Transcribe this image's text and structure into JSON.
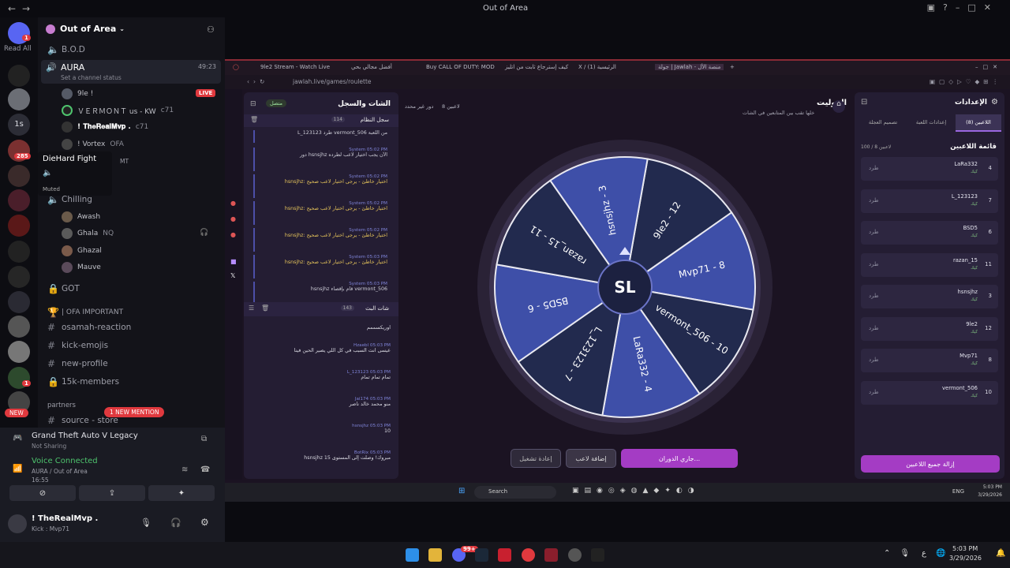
{
  "window": {
    "title": "Out of Area"
  },
  "rail": {
    "read_all": "Read All",
    "badges": [
      "1",
      "285",
      "1",
      "1",
      "1"
    ],
    "new_label": "NEW"
  },
  "server": {
    "name": "Out of Area"
  },
  "channels": {
    "bod": "B.O.D",
    "aura": "AURA",
    "aura_timer": "49:23",
    "aura_status": "Set a channel status",
    "chilling": "Chilling",
    "got": "GOT",
    "category": "| OFA IMPORTANT",
    "text": [
      "osamah-reaction",
      "kick-emojis",
      "new-profile",
      "15k-members"
    ],
    "partners": "partners",
    "source": "source - store",
    "mention_pill": "1 NEW MENTION"
  },
  "voice_users": [
    {
      "name": "9le !",
      "extra": "",
      "live": "LIVE"
    },
    {
      "name": "ＶＥＲＭＯＮＴ us - KW",
      "extra": "c71"
    },
    {
      "name": "! 𝐓𝐡𝐞𝐑𝐞𝐚𝐥𝐌𝐯𝐩 .",
      "extra": "c71"
    },
    {
      "name": "! Vortex",
      "extra": "OFA"
    }
  ],
  "chilling_users": [
    "Awash",
    "Ghala",
    "Ghazal",
    "Mauve"
  ],
  "chilling_extra": "NQ",
  "tooltip": {
    "title": "DieHard Fight",
    "muted": "Muted",
    "tag": "MT"
  },
  "voice_panel": {
    "game": "Grand Theft Auto V Legacy",
    "sharing": "Not Sharing",
    "connected": "Voice Connected",
    "channel": "AURA / Out of Area",
    "time": "16:55"
  },
  "user_panel": {
    "name": "! TheRealMvp .",
    "status": "Kick : Mvp71"
  },
  "browser": {
    "tabs": [
      "9le2 Stream - Watch Live",
      "أفضل مجالي بحي",
      "Buy CALL OF DUTY: MOD",
      "كيف إسترجاع ثابت من اتليز",
      "X / الرئيسية (1)",
      "جولة | Jawlah - منصة الأل"
    ],
    "url": "jawlah.live/games/roulette"
  },
  "chat_panel": {
    "title": "الشات والسجل",
    "online": "متصل",
    "log_title": "سجل النظام",
    "log_count": "114",
    "live_chat_title": "شات البث",
    "live_count": "143",
    "log": [
      {
        "meta": "",
        "text": "L_123123 طرد vermont_506 من اللعبة",
        "warn": false
      },
      {
        "meta": "System  05:02 PM",
        "text": "دور hsnsjhz الآن يجب اختيار لاعب لطرده",
        "warn": false
      },
      {
        "meta": "System  05:02 PM",
        "text": "hsnsjhz: اختيار خاطئ - يرجى اختيار لاعب صحيح",
        "warn": true
      },
      {
        "meta": "System  05:02 PM",
        "text": "hsnsjhz: اختيار خاطئ - يرجى اختيار لاعب صحيح",
        "warn": true
      },
      {
        "meta": "System  05:02 PM",
        "text": "hsnsjhz: اختيار خاطئ - يرجى اختيار لاعب صحيح",
        "warn": true
      },
      {
        "meta": "System  05:03 PM",
        "text": "hsnsjhz: اختيار خاطئ - يرجى اختيار لاعب صحيح",
        "warn": true
      },
      {
        "meta": "System  05:03 PM",
        "text": "hsnsjhz قام بإقصاء vermont_506",
        "warn": false
      }
    ],
    "messages": [
      {
        "meta": "",
        "text": "اوريكسممم"
      },
      {
        "meta": "Hzaebl  05:03 PM",
        "text": "عيسى انت السبب في كل اللي يصير الحين فينا"
      },
      {
        "meta": "L_123123  05:03 PM",
        "text": "تمام تمام تمام"
      },
      {
        "meta": "Jai174  05:03 PM",
        "text": "منو محمد خالد ناصر"
      },
      {
        "meta": "hsnsjhz  05:03 PM",
        "text": "10"
      },
      {
        "meta": "BotRix  05:03 PM",
        "text": "hsnsjhz مبروك! وصلت إلى المستوى 15"
      }
    ]
  },
  "game": {
    "title": "الروليت",
    "subtitle": "خلها تقب بين المتابعين في الشات",
    "players_badge": "8 لاعبين",
    "turn_label": "دور غير محدد",
    "wheel_labels": [
      "9le2 - 12",
      "Mvp71 - 8",
      "vermont_506 - 10",
      "LaRa332 - 4",
      "L_123123 - 7",
      "BSD5 - 6",
      "razan_15 - 11",
      "hsnsjhz - 3"
    ],
    "spin_button": "جاري الدوران...",
    "add_player_button": "إضافة لاعب",
    "restart_button": "إعادة تشغيل"
  },
  "settings": {
    "title": "الإعدادات",
    "tabs": [
      "اللاعبين (8)",
      "إعدادات اللعبة",
      "تصميم العجلة"
    ],
    "list_title": "قائمة اللاعبين",
    "count": "100 / 8 لاعبين",
    "kick_label": "طرد",
    "status_label": "كيك",
    "players": [
      {
        "name": "LaRa332",
        "num": "4"
      },
      {
        "name": "L_123123",
        "num": "7"
      },
      {
        "name": "BSD5",
        "num": "6"
      },
      {
        "name": "razan_15",
        "num": "11"
      },
      {
        "name": "hsnsjhz",
        "num": "3"
      },
      {
        "name": "9le2",
        "num": "12"
      },
      {
        "name": "Mvp71",
        "num": "8"
      },
      {
        "name": "vermont_506",
        "num": "10"
      }
    ],
    "remove_all": "إزالة جميع اللاعبين"
  },
  "inner_taskbar": {
    "search": "Search",
    "lang": "ENG",
    "time": "5:03 PM",
    "date": "3/29/2026"
  },
  "taskbar": {
    "lang": "ع",
    "time": "5:03 PM",
    "date": "3/29/2026",
    "badge": "99+"
  },
  "colors": {
    "accent": "#a43cc4",
    "wheel_light": "#3e4fa8",
    "wheel_dark": "#222a4e",
    "discord_bg": "#131319",
    "live": "#e0393e"
  }
}
